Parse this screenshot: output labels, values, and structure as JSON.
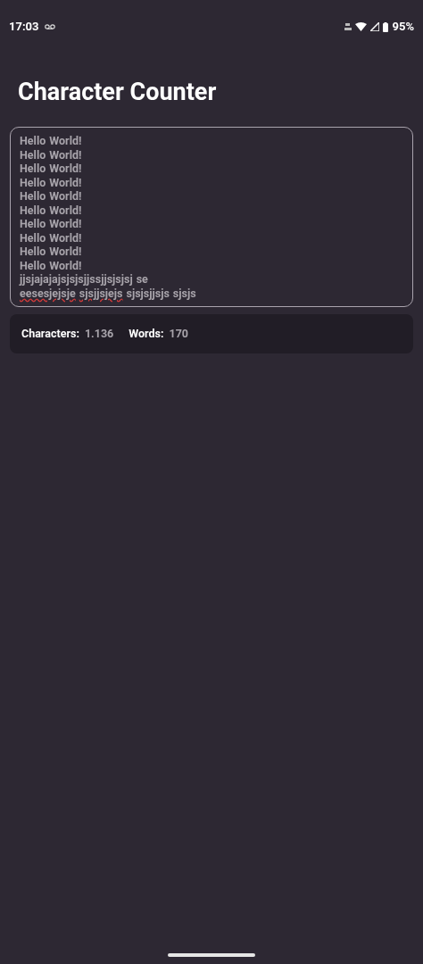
{
  "status_bar": {
    "time": "17:03",
    "battery": "95%"
  },
  "title": "Character Counter",
  "editor": {
    "lines": [
      [
        {
          "text": "Hello",
          "misspelled": false
        },
        {
          "text": "World!",
          "misspelled": false
        }
      ],
      [
        {
          "text": "Hello",
          "misspelled": false
        },
        {
          "text": "World!",
          "misspelled": false
        }
      ],
      [
        {
          "text": "Hello",
          "misspelled": false
        },
        {
          "text": "World!",
          "misspelled": false
        }
      ],
      [
        {
          "text": "Hello",
          "misspelled": false
        },
        {
          "text": "World!",
          "misspelled": false
        }
      ],
      [
        {
          "text": "Hello",
          "misspelled": false
        },
        {
          "text": "World!",
          "misspelled": false
        }
      ],
      [
        {
          "text": "Hello",
          "misspelled": false
        },
        {
          "text": "World!",
          "misspelled": false
        }
      ],
      [
        {
          "text": "Hello",
          "misspelled": false
        },
        {
          "text": "World!",
          "misspelled": false
        }
      ],
      [
        {
          "text": "Hello",
          "misspelled": false
        },
        {
          "text": "World!",
          "misspelled": false
        }
      ],
      [
        {
          "text": "Hello",
          "misspelled": false
        },
        {
          "text": "World!",
          "misspelled": false
        }
      ],
      [
        {
          "text": "Hello",
          "misspelled": false
        },
        {
          "text": "World!",
          "misspelled": false
        }
      ],
      [
        {
          "text": "jjsjajajajsjsjsjjssjjsjsjsj",
          "misspelled": false
        },
        {
          "text": "se",
          "misspelled": false
        }
      ],
      [
        {
          "text": "eesesjejsje",
          "misspelled": true
        },
        {
          "text": "sjsjjsjejs",
          "misspelled": true
        },
        {
          "text": "sjsjsjjsjs",
          "misspelled": false
        },
        {
          "text": "sjsjs",
          "misspelled": false
        }
      ]
    ]
  },
  "stats": [
    {
      "label": "Characters:",
      "value": "1.136"
    },
    {
      "label": "Words:",
      "value": "170"
    }
  ]
}
